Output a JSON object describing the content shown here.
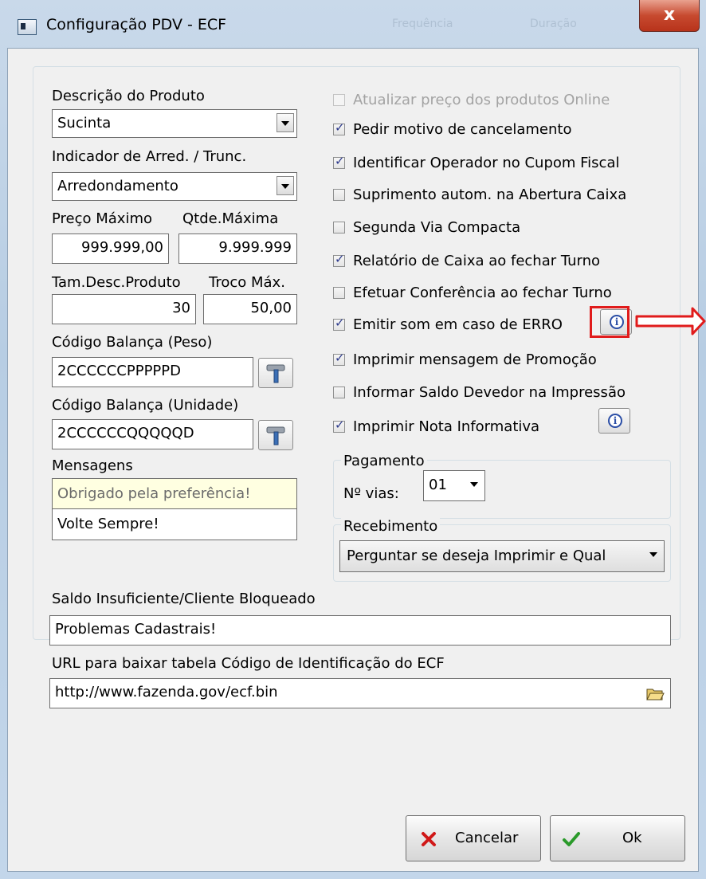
{
  "window": {
    "title": "Configuração PDV - ECF",
    "close_label": "x",
    "background_tabs": [
      "Frequência",
      "Duração"
    ]
  },
  "left": {
    "descricao_label": "Descrição do Produto",
    "descricao_value": "Sucinta",
    "indicador_label": "Indicador de Arred. / Trunc.",
    "indicador_value": "Arredondamento",
    "preco_max_label": "Preço Máximo",
    "preco_max_value": "999.999,00",
    "qtde_max_label": "Qtde.Máxima",
    "qtde_max_value": "9.999.999",
    "tam_desc_label": "Tam.Desc.Produto",
    "tam_desc_value": "30",
    "troco_max_label": "Troco Máx.",
    "troco_max_value": "50,00",
    "cod_peso_label": "Código Balança (Peso)",
    "cod_peso_value": "2CCCCCCPPPPPD",
    "cod_unid_label": "Código Balança (Unidade)",
    "cod_unid_value": "2CCCCCCQQQQQD",
    "mensagens_label": "Mensagens",
    "mensagem_1": "Obrigado pela preferência!",
    "mensagem_2": "Volte Sempre!"
  },
  "options": [
    {
      "label": "Atualizar preço dos produtos Online",
      "checked": false,
      "disabled": true
    },
    {
      "label": "Pedir motivo de cancelamento",
      "checked": true,
      "disabled": false
    },
    {
      "label": "Identificar Operador no Cupom Fiscal",
      "checked": true,
      "disabled": false
    },
    {
      "label": "Suprimento autom. na Abertura Caixa",
      "checked": false,
      "disabled": false
    },
    {
      "label": "Segunda Via Compacta",
      "checked": false,
      "disabled": false
    },
    {
      "label": "Relatório de Caixa ao fechar Turno",
      "checked": true,
      "disabled": false
    },
    {
      "label": "Efetuar Conferência ao fechar Turno",
      "checked": false,
      "disabled": false
    },
    {
      "label": "Emitir som em caso de ERRO",
      "checked": true,
      "disabled": false
    },
    {
      "label": "Imprimir mensagem de Promoção",
      "checked": true,
      "disabled": false
    },
    {
      "label": "Informar Saldo Devedor na Impressão",
      "checked": false,
      "disabled": false
    },
    {
      "label": "Imprimir Nota Informativa",
      "checked": true,
      "disabled": false
    }
  ],
  "pagamento": {
    "title": "Pagamento",
    "vias_label": "Nº vias:",
    "vias_value": "01"
  },
  "recebimento": {
    "title": "Recebimento",
    "value": "Perguntar se deseja Imprimir e Qual"
  },
  "saldo": {
    "label": "Saldo Insuficiente/Cliente Bloqueado",
    "value": "Problemas Cadastrais!"
  },
  "url": {
    "label": "URL para baixar tabela Código de Identificação do ECF",
    "value": "http://www.fazenda.gov/ecf.bin"
  },
  "buttons": {
    "cancel": "Cancelar",
    "ok": "Ok"
  },
  "colors": {
    "highlight_box": "#e01b1b",
    "cancel_icon": "#d01818",
    "ok_icon": "#2a9a2a",
    "message_bg": "#ffffe1"
  }
}
